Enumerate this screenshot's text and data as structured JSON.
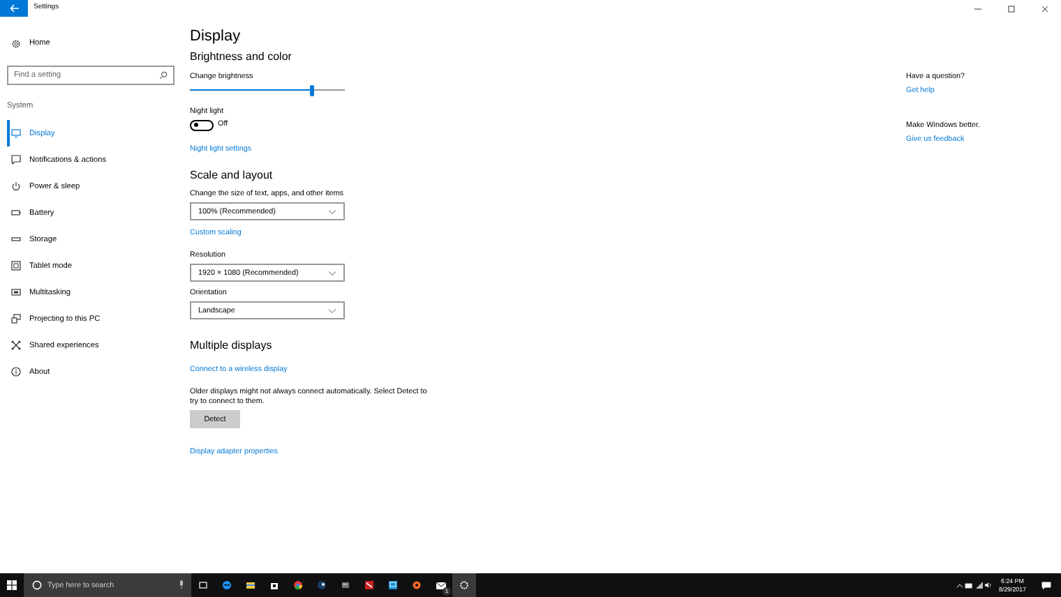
{
  "window": {
    "title": "Settings"
  },
  "sidebar": {
    "home": "Home",
    "search": {
      "placeholder": "Find a setting"
    },
    "section": "System",
    "items": [
      {
        "label": "Display",
        "selected": true
      },
      {
        "label": "Notifications & actions",
        "selected": false
      },
      {
        "label": "Power & sleep",
        "selected": false
      },
      {
        "label": "Battery",
        "selected": false
      },
      {
        "label": "Storage",
        "selected": false
      },
      {
        "label": "Tablet mode",
        "selected": false
      },
      {
        "label": "Multitasking",
        "selected": false
      },
      {
        "label": "Projecting to this PC",
        "selected": false
      },
      {
        "label": "Shared experiences",
        "selected": false
      },
      {
        "label": "About",
        "selected": false
      }
    ]
  },
  "page": {
    "title": "Display",
    "brightness": {
      "heading": "Brightness and color",
      "label": "Change brightness",
      "level": 0.79
    },
    "night_light": {
      "label": "Night light",
      "on": false,
      "state_text": "Off",
      "link": "Night light settings"
    },
    "scale": {
      "heading": "Scale and layout",
      "size_label": "Change the size of text, apps, and other items",
      "size_value": "100% (Recommended)",
      "custom_link": "Custom scaling",
      "resolution_label": "Resolution",
      "resolution_value": "1920 × 1080 (Recommended)",
      "orientation_label": "Orientation",
      "orientation_value": "Landscape"
    },
    "multiple": {
      "heading": "Multiple displays",
      "wireless_link": "Connect to a wireless display",
      "note": "Older displays might not always connect automatically. Select Detect to try to connect to them.",
      "detect_button": "Detect",
      "adapter_link": "Display adapter properties"
    }
  },
  "aside": [
    {
      "question": "Have a question?",
      "link": "Get help"
    },
    {
      "question": "Make Windows better.",
      "link": "Give us feedback"
    }
  ],
  "taskbar": {
    "search": {
      "placeholder": "Type here to search"
    },
    "mail_badge": "1",
    "time": "6:24 PM",
    "date": "8/29/2017"
  }
}
